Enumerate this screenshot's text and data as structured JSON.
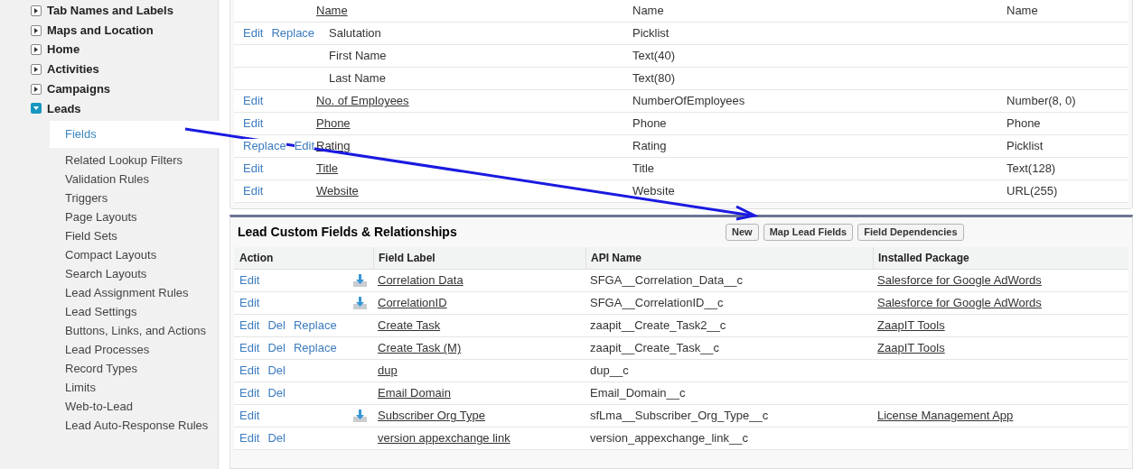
{
  "sidebar": {
    "items": [
      {
        "label": "Tab Names and Labels",
        "expanded": false
      },
      {
        "label": "Maps and Location",
        "expanded": false
      },
      {
        "label": "Home",
        "expanded": false
      },
      {
        "label": "Activities",
        "expanded": false
      },
      {
        "label": "Campaigns",
        "expanded": false
      },
      {
        "label": "Leads",
        "expanded": true,
        "children": [
          {
            "label": "Fields",
            "selected": true
          },
          {
            "label": "Related Lookup Filters",
            "selected": false
          },
          {
            "label": "Validation Rules",
            "selected": false
          },
          {
            "label": "Triggers",
            "selected": false
          },
          {
            "label": "Page Layouts",
            "selected": false
          },
          {
            "label": "Field Sets",
            "selected": false
          },
          {
            "label": "Compact Layouts",
            "selected": false
          },
          {
            "label": "Search Layouts",
            "selected": false
          },
          {
            "label": "Lead Assignment Rules",
            "selected": false
          },
          {
            "label": "Lead Settings",
            "selected": false
          },
          {
            "label": "Buttons, Links, and Actions",
            "selected": false
          },
          {
            "label": "Lead Processes",
            "selected": false
          },
          {
            "label": "Record Types",
            "selected": false
          },
          {
            "label": "Limits",
            "selected": false
          },
          {
            "label": "Web-to-Lead",
            "selected": false
          },
          {
            "label": "Lead Auto-Response Rules",
            "selected": false
          }
        ]
      }
    ]
  },
  "standard_fields": {
    "rows": [
      {
        "kind": "field",
        "actions": [],
        "label": "Name",
        "api_name": "Name",
        "type": "Name"
      },
      {
        "kind": "subfield",
        "actions": [
          "Edit",
          "Replace"
        ],
        "label": "Salutation",
        "api_name": "Picklist",
        "type": ""
      },
      {
        "kind": "subfield",
        "actions": [],
        "label": "First Name",
        "api_name": "Text(40)",
        "type": ""
      },
      {
        "kind": "subfield",
        "actions": [],
        "label": "Last Name",
        "api_name": "Text(80)",
        "type": ""
      },
      {
        "kind": "field",
        "actions": [
          "Edit"
        ],
        "label": "No. of Employees",
        "api_name": "NumberOfEmployees",
        "type": "Number(8, 0)"
      },
      {
        "kind": "field",
        "actions": [
          "Edit"
        ],
        "label": "Phone",
        "api_name": "Phone",
        "type": "Phone"
      },
      {
        "kind": "field",
        "actions": [
          "Replace",
          "Edit"
        ],
        "label": "Rating",
        "api_name": "Rating",
        "type": "Picklist"
      },
      {
        "kind": "field",
        "actions": [
          "Edit"
        ],
        "label": "Title",
        "api_name": "Title",
        "type": "Text(128)"
      },
      {
        "kind": "field",
        "actions": [
          "Edit"
        ],
        "label": "Website",
        "api_name": "Website",
        "type": "URL(255)"
      }
    ]
  },
  "custom_fields": {
    "title": "Lead Custom Fields & Relationships",
    "buttons": [
      "New",
      "Map Lead Fields",
      "Field Dependencies"
    ],
    "columns": [
      "Action",
      "Field Label",
      "API Name",
      "Installed Package"
    ],
    "rows": [
      {
        "actions": [
          "Edit"
        ],
        "managed": true,
        "label": "Correlation Data",
        "api_name": "SFGA__Correlation_Data__c",
        "package": "Salesforce for Google AdWords"
      },
      {
        "actions": [
          "Edit"
        ],
        "managed": true,
        "label": "CorrelationID",
        "api_name": "SFGA__CorrelationID__c",
        "package": "Salesforce for Google AdWords"
      },
      {
        "actions": [
          "Edit",
          "Del",
          "Replace"
        ],
        "managed": false,
        "label": "Create Task",
        "api_name": "zaapit__Create_Task2__c",
        "package": "ZaapIT Tools"
      },
      {
        "actions": [
          "Edit",
          "Del",
          "Replace"
        ],
        "managed": false,
        "label": "Create Task (M)",
        "api_name": "zaapit__Create_Task__c",
        "package": "ZaapIT Tools"
      },
      {
        "actions": [
          "Edit",
          "Del"
        ],
        "managed": false,
        "label": "dup",
        "api_name": "dup__c",
        "package": ""
      },
      {
        "actions": [
          "Edit",
          "Del"
        ],
        "managed": false,
        "label": "Email Domain",
        "api_name": "Email_Domain__c",
        "package": ""
      },
      {
        "actions": [
          "Edit"
        ],
        "managed": true,
        "label": "Subscriber Org Type",
        "api_name": "sfLma__Subscriber_Org_Type__c",
        "package": "License Management App"
      },
      {
        "actions": [
          "Edit",
          "Del"
        ],
        "managed": false,
        "label": "version appexchange link",
        "api_name": "version_appexchange_link__c",
        "package": ""
      }
    ]
  }
}
